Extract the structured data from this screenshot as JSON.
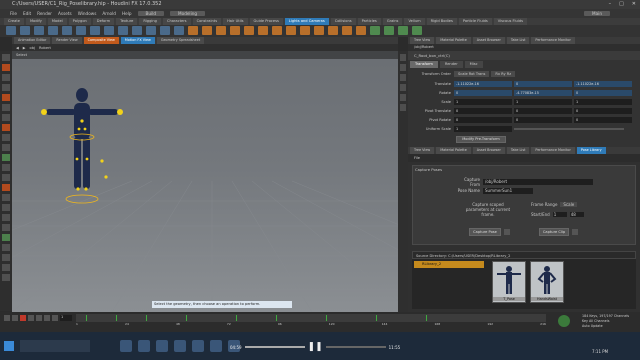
{
  "window": {
    "title": "C:/Users/USER/C1_Rig_Poselibrary.hip - Houdini FX 17.0.352"
  },
  "menu": {
    "items": [
      "File",
      "Edit",
      "Render",
      "Assets",
      "Windows",
      "Arnold",
      "Help"
    ],
    "build_label": "Build",
    "modeling_label": "Modeling",
    "main_label": "Main"
  },
  "shelf_tabs": [
    "Create",
    "Modify",
    "Model",
    "Polygon",
    "Deform",
    "Texture",
    "Rigging",
    "Characters",
    "Constraints",
    "Hair Utils",
    "Guide Process",
    "Terrain FX",
    "Simple FX",
    "Lights and Cameras",
    "Collisions",
    "Particles",
    "Grains",
    "Vellum",
    "Rigid Bodies",
    "Particle Fluids",
    "Viscous Fluids",
    "Oceans",
    "Fluid Containers"
  ],
  "viewport": {
    "tabs": [
      "Animation Editor",
      "Render View",
      "Composite View",
      "Motion FX View",
      "Geometry Spreadsheet"
    ],
    "path": [
      "obj",
      "Robert"
    ],
    "header_label": "Select",
    "status_message": "Select the geometry, then choose an operation to perform."
  },
  "params": {
    "tabs": [
      "Tree View",
      "Material Palette",
      "Asset Browser",
      "Take List",
      "Performance Monitor"
    ],
    "path": "/obj/Robert",
    "node_name": "C_Root_bon_ctrl(C)",
    "subtabs": [
      "Transform",
      "Render",
      "Misc"
    ],
    "transform_order_label": "Transform Order",
    "transform_order_value": "Scale Rot Trans",
    "rot_order_value": "Rx Ry Rz",
    "rows": [
      {
        "label": "Translate",
        "v": [
          "-1.11022e-16",
          "0",
          "-1.11022e-16"
        ]
      },
      {
        "label": "Rotate",
        "v": [
          "0",
          "-4.77083e-15",
          "0"
        ]
      },
      {
        "label": "Scale",
        "v": [
          "1",
          "1",
          "1"
        ]
      },
      {
        "label": "Pivot Translate",
        "v": [
          "0",
          "0",
          "0"
        ]
      },
      {
        "label": "Pivot Rotate",
        "v": [
          "0",
          "0",
          "0"
        ]
      },
      {
        "label": "Uniform Scale",
        "v": [
          "1",
          "",
          ""
        ]
      }
    ],
    "modify_button": "Modify Pre-Transform"
  },
  "poselib": {
    "tabs": [
      "Tree View",
      "Material Palette",
      "Asset Browser",
      "Take List",
      "Performance Monitor",
      "Pose Library"
    ],
    "path_label": "File",
    "section": "Capture Poses",
    "capture_from_label": "Capture From",
    "capture_from_value": "/obj/Robert",
    "pose_name_label": "Pose Name",
    "pose_name_value": "SummerSun1",
    "info_text": "Capture scoped parameters at current frame.",
    "frame_range_label": "Frame Range",
    "frame_range_value": "Scale",
    "start_end_label": "Start/End",
    "start_value": "1",
    "end_value": "48",
    "capture_pose_button": "Capture Pose",
    "capture_clip_button": "Capture Clip",
    "source_dir": "Source Directory: C:/Users/USER/Desktop/RLibrary_2",
    "library_item": "RLibrary_2",
    "thumbs": [
      "T_Pose",
      "HandsWaist"
    ]
  },
  "timeline": {
    "frame": "1",
    "ticks": [
      "1",
      "24",
      "48",
      "72",
      "96",
      "120",
      "144",
      "168",
      "192",
      "216"
    ],
    "info_lines": [
      "184 Keys, 197/197 Channels",
      "Key All Channels",
      "Auto Update"
    ]
  },
  "taskbar": {
    "search_placeholder": "",
    "media_time": "04:59",
    "media_time_end": "11:55",
    "clock": "7:11 PM"
  }
}
